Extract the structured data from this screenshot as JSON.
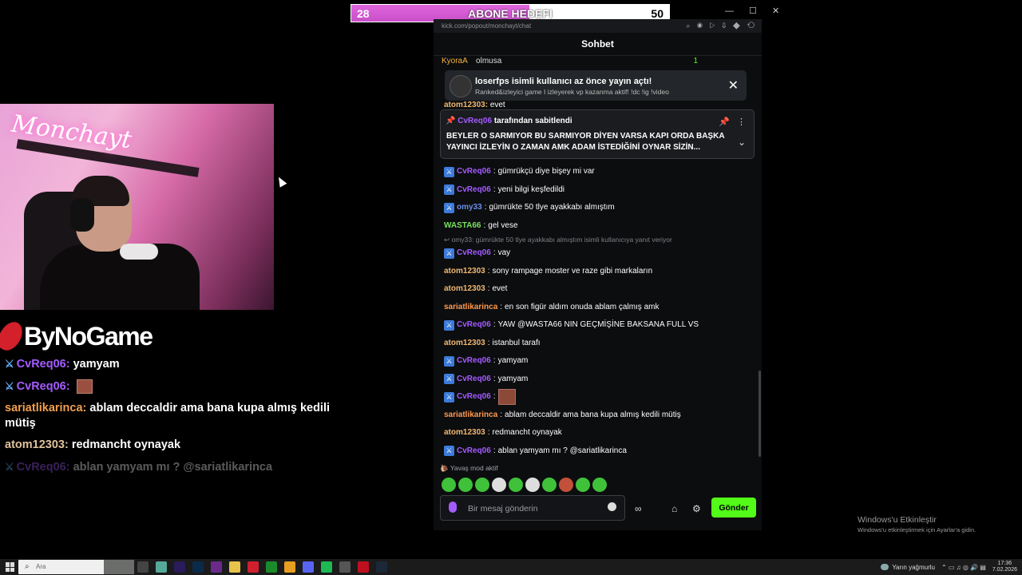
{
  "sub_goal": {
    "current": "28",
    "title": "ABONE HEDEFI",
    "target": "50",
    "progress": 0.56
  },
  "window_controls": "— ☐ ✕",
  "webcam": {
    "sign_text": "Monchayt"
  },
  "overlay": {
    "sponsor": "ByNoGame",
    "chat": [
      {
        "user": "CvReq06:",
        "text": "yamyam",
        "color": "purple",
        "badge": true
      },
      {
        "user": "CvReq06:",
        "text": "",
        "color": "purple",
        "badge": true,
        "emote": true
      },
      {
        "user": "sariatlikarinca:",
        "text": "ablam deccaldir ama bana kupa almış kedili mütiş",
        "color": "orange",
        "badge": false
      },
      {
        "user": "atom12303:",
        "text": "redmancht oynayak",
        "color": "tan",
        "badge": false
      },
      {
        "user": "CvReq06:",
        "text": "ablan yamyam mı ? @sariatlikarinca",
        "color": "purple",
        "badge": true,
        "faded": true
      }
    ]
  },
  "chat_panel": {
    "url": "kick.com/popout/monchayt/chat",
    "header": "Sohbet",
    "leaderboard": {
      "user": "KyoraA",
      "user2": "olmusa",
      "count": "1"
    },
    "host_banner": {
      "title": "loserfps isimli kullanıcı az önce yayın açtı!",
      "subtitle": "Ranked&izleyici game I izleyerek vp kazanma aktif! !dc !ig !video",
      "close": "✕",
      "prev_user": "atom12303:",
      "prev_text": "evet"
    },
    "pinned": {
      "by_user": "CvReq06",
      "by_text": "tarafından sabitlendi",
      "body": "BEYLER O SARMIYOR BU SARMIYOR DİYEN VARSA KAPI ORDA BAŞKA YAYINCI İZLEYİN O ZAMAN AMK ADAM İSTEDİĞİNİ OYNAR SİZİN...",
      "pin_icon": "📌",
      "more_icon": "⋮",
      "expand_icon": "⌄"
    },
    "messages": [
      {
        "user": "CvReq06",
        "text": "gümrükçü diye bişey mi var",
        "color": "purple",
        "badge": true
      },
      {
        "user": "CvReq06",
        "text": "yeni bilgi keşfedildi",
        "color": "purple",
        "badge": true
      },
      {
        "user": "omy33",
        "text": "gümrükte 50 tlye ayakkabı almıştım",
        "color": "blue",
        "badge": true
      },
      {
        "user": "WASTA66",
        "text": "gel vese",
        "color": "green",
        "badge": false
      },
      {
        "reply": "omy33: gümrükte 50 tlye ayakkabı almıştım isimli kullanıcıya yanıt veriyor"
      },
      {
        "user": "CvReq06",
        "text": "vay",
        "color": "purple",
        "badge": true
      },
      {
        "user": "atom12303",
        "text": "sony rampage moster ve raze gibi markaların",
        "color": "tan",
        "badge": false
      },
      {
        "user": "atom12303",
        "text": "evet",
        "color": "tan",
        "badge": false
      },
      {
        "user": "sariatlikarinca",
        "text": "en son figür aldım onuda ablam çalmış amk",
        "color": "orange",
        "badge": false
      },
      {
        "user": "CvReq06",
        "text": "YAW @WASTA66 NIN GEÇMİŞİNE BAKSANA FULL VS",
        "color": "purple",
        "badge": true
      },
      {
        "user": "atom12303",
        "text": "istanbul tarafı",
        "color": "tan",
        "badge": false
      },
      {
        "user": "CvReq06",
        "text": "yamyam",
        "color": "purple",
        "badge": true
      },
      {
        "user": "CvReq06",
        "text": "yamyam",
        "color": "purple",
        "badge": true
      },
      {
        "user": "CvReq06",
        "text": "",
        "color": "purple",
        "badge": true,
        "emote": true
      },
      {
        "user": "sariatlikarinca",
        "text": "ablam deccaldir ama bana kupa almış kedili mütiş",
        "color": "orange",
        "badge": false
      },
      {
        "user": "atom12303",
        "text": "redmancht oynayak",
        "color": "tan",
        "badge": false
      },
      {
        "user": "CvReq06",
        "text": "ablan yamyam mı ? @sariatlikarinca",
        "color": "purple",
        "badge": true
      }
    ],
    "slow_mode": "Yavaş mod aktif",
    "input_placeholder": "Bir mesaj gönderin",
    "send_label": "Gönder",
    "tool_icons": {
      "points": "∞",
      "store": "⌂",
      "settings": "⚙"
    }
  },
  "watermark": {
    "title": "Windows'u Etkinleştir",
    "subtitle": "Windows'u etkinleştirmek için Ayarlar'a gidin."
  },
  "taskbar": {
    "search_placeholder": "Ara",
    "weather": "Yarın yağmurlu",
    "time": "17:36",
    "date": "7.02.2026"
  }
}
